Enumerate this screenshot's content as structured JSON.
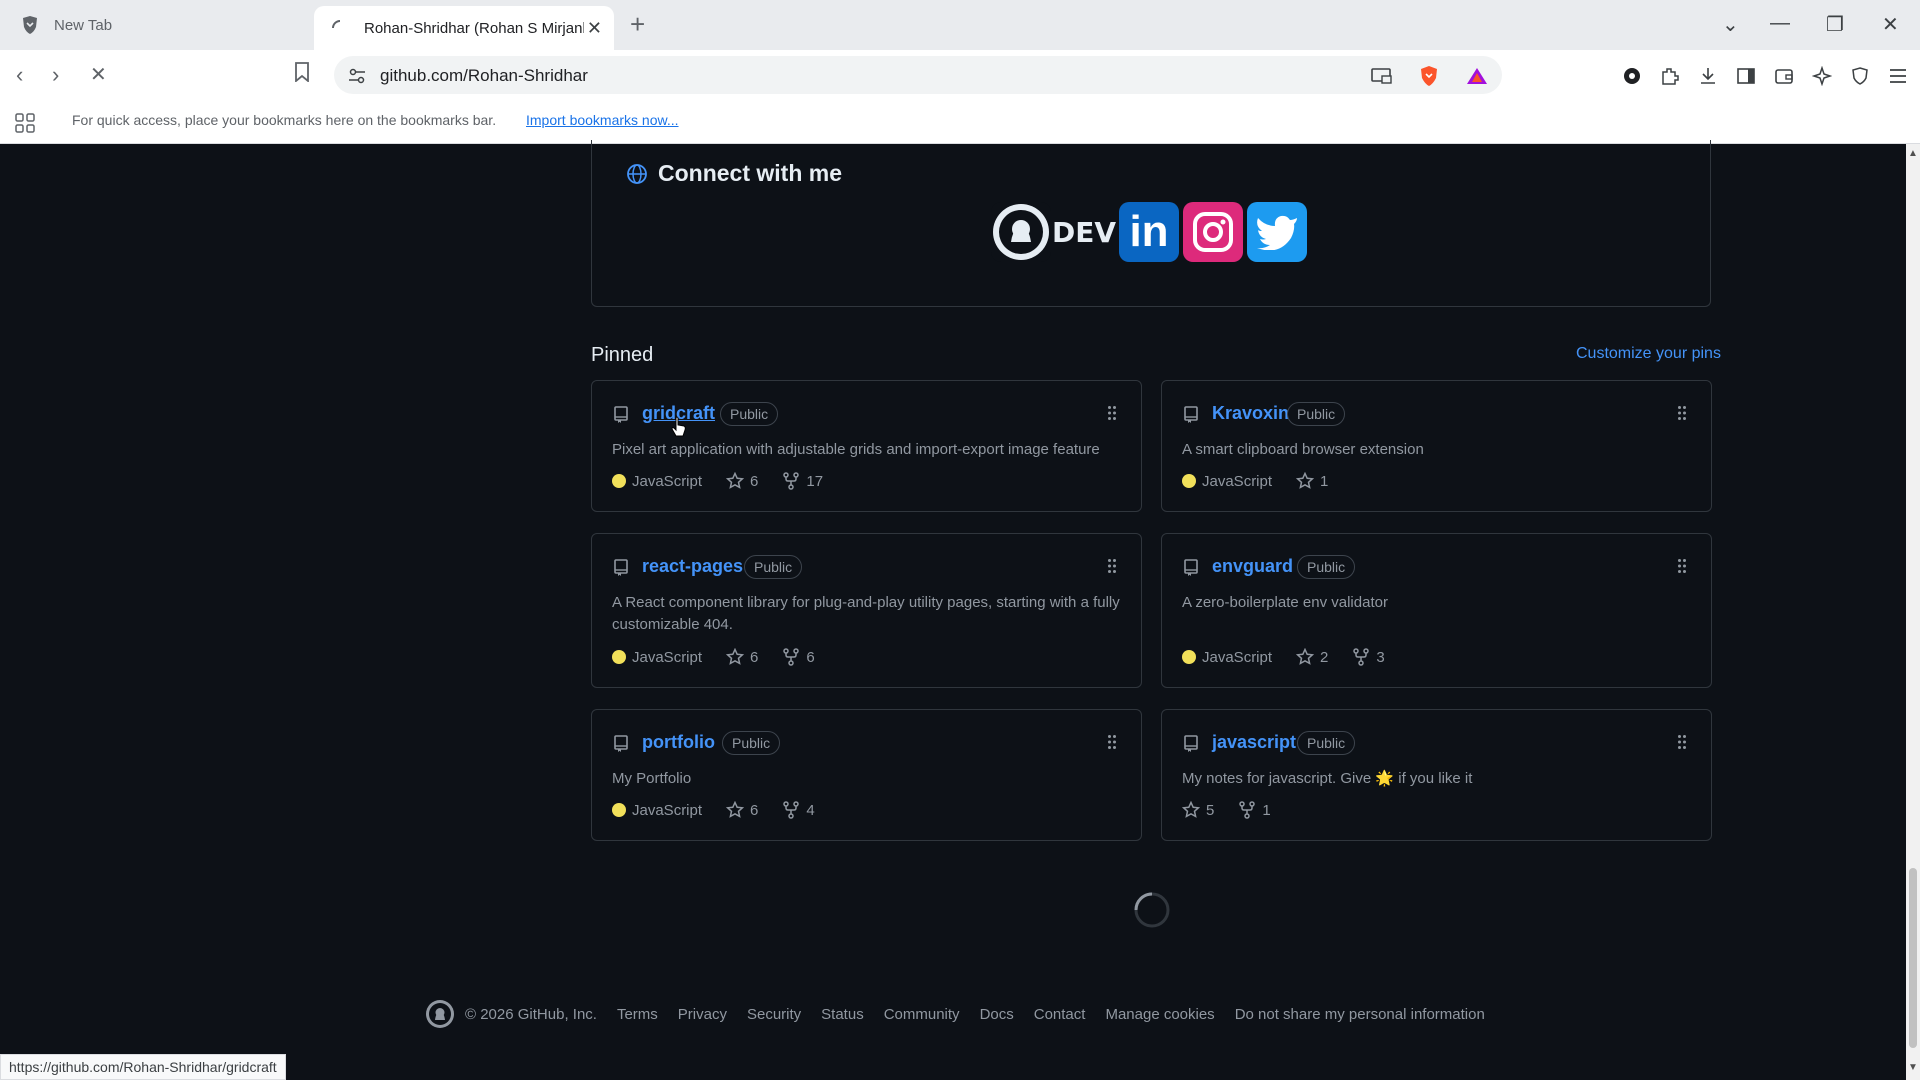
{
  "browser": {
    "tabs": [
      {
        "title": "New Tab",
        "icon": "brave-shield-icon"
      },
      {
        "title": "Rohan-Shridhar (Rohan S Mirjankar)",
        "icon": "loading-icon"
      }
    ],
    "url": "github.com/Rohan-Shridhar",
    "bookmarks_bar": {
      "message": "For quick access, place your bookmarks here on the bookmarks bar.",
      "import_link": "Import bookmarks now..."
    },
    "status_url": "https://github.com/Rohan-Shridhar/gridcraft"
  },
  "readme": {
    "connect_title": "Connect with me",
    "socials": [
      "github",
      "dev",
      "linkedin",
      "instagram",
      "twitter"
    ],
    "dev_label": "DEV",
    "linkedin_label": "in"
  },
  "pinned": {
    "title": "Pinned",
    "customize_label": "Customize your pins",
    "repos": [
      {
        "name": "gridcraft",
        "visibility": "Public",
        "description": "Pixel art application with adjustable grids and import-export image feature",
        "language": "JavaScript",
        "stars": "6",
        "forks": "17"
      },
      {
        "name": "Kravoxin",
        "visibility": "Public",
        "description": "A smart clipboard browser extension",
        "language": "JavaScript",
        "stars": "1",
        "forks": ""
      },
      {
        "name": "react-pages",
        "visibility": "Public",
        "description": "A React component library for plug-and-play utility pages, starting with a fully customizable 404.",
        "language": "JavaScript",
        "stars": "6",
        "forks": "6"
      },
      {
        "name": "envguard",
        "visibility": "Public",
        "description": "A zero-boilerplate env validator",
        "language": "JavaScript",
        "stars": "2",
        "forks": "3"
      },
      {
        "name": "portfolio",
        "visibility": "Public",
        "description": "My Portfolio",
        "language": "JavaScript",
        "stars": "6",
        "forks": "4"
      },
      {
        "name": "javascript",
        "visibility": "Public",
        "description": "My notes for javascript. Give 🌟 if you like it",
        "language": "",
        "stars": "5",
        "forks": "1"
      }
    ]
  },
  "footer": {
    "copyright": "© 2026 GitHub, Inc.",
    "links": [
      "Terms",
      "Privacy",
      "Security",
      "Status",
      "Community",
      "Docs",
      "Contact",
      "Manage cookies",
      "Do not share my personal information"
    ]
  },
  "colors": {
    "javascript": "#f1e05a",
    "link": "#4493f8",
    "background": "#0d1117"
  }
}
